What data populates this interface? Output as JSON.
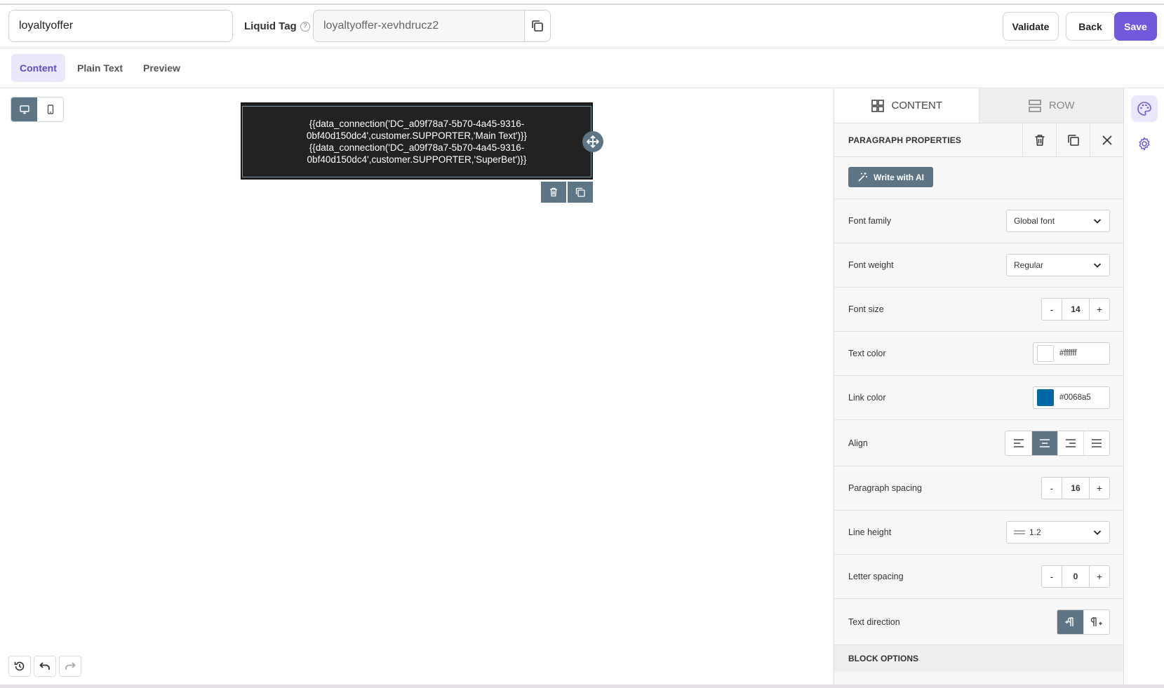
{
  "header": {
    "name_value": "loyaltyoffer",
    "liquid_tag_label": "Liquid Tag",
    "liquid_tag_value": "loyaltyoffer-xevhdrucz2",
    "validate_label": "Validate",
    "back_label": "Back",
    "save_label": "Save",
    "accent_color": "#7258db"
  },
  "tabs": [
    {
      "label": "Content",
      "active": true
    },
    {
      "label": "Plain Text",
      "active": false
    },
    {
      "label": "Preview",
      "active": false
    }
  ],
  "canvas": {
    "block_lines": [
      "{{data_connection('DC_a09f78a7-5b70-4a45-9316-",
      "0bf40d150dc4',customer.SUPPORTER,'Main Text')}}",
      "{{data_connection('DC_a09f78a7-5b70-4a45-9316-",
      "0bf40d150dc4',customer.SUPPORTER,'SuperBet')}}"
    ]
  },
  "panel": {
    "tab_content": "CONTENT",
    "tab_row": "ROW",
    "section_title": "PARAGRAPH PROPERTIES",
    "ai_button": "Write with AI",
    "font_family": {
      "label": "Font family",
      "value": "Global font"
    },
    "font_weight": {
      "label": "Font weight",
      "value": "Regular"
    },
    "font_size": {
      "label": "Font size",
      "value": "14"
    },
    "text_color": {
      "label": "Text color",
      "value": "#ffffff"
    },
    "link_color": {
      "label": "Link color",
      "value": "#0068a5"
    },
    "align": {
      "label": "Align",
      "selected": "center"
    },
    "paragraph_spacing": {
      "label": "Paragraph spacing",
      "value": "16"
    },
    "line_height": {
      "label": "Line height",
      "value": "1.2"
    },
    "letter_spacing": {
      "label": "Letter spacing",
      "value": "0"
    },
    "text_direction": {
      "label": "Text direction",
      "selected": "ltr"
    },
    "block_options": "BLOCK OPTIONS",
    "stepper_minus": "-",
    "stepper_plus": "+"
  }
}
